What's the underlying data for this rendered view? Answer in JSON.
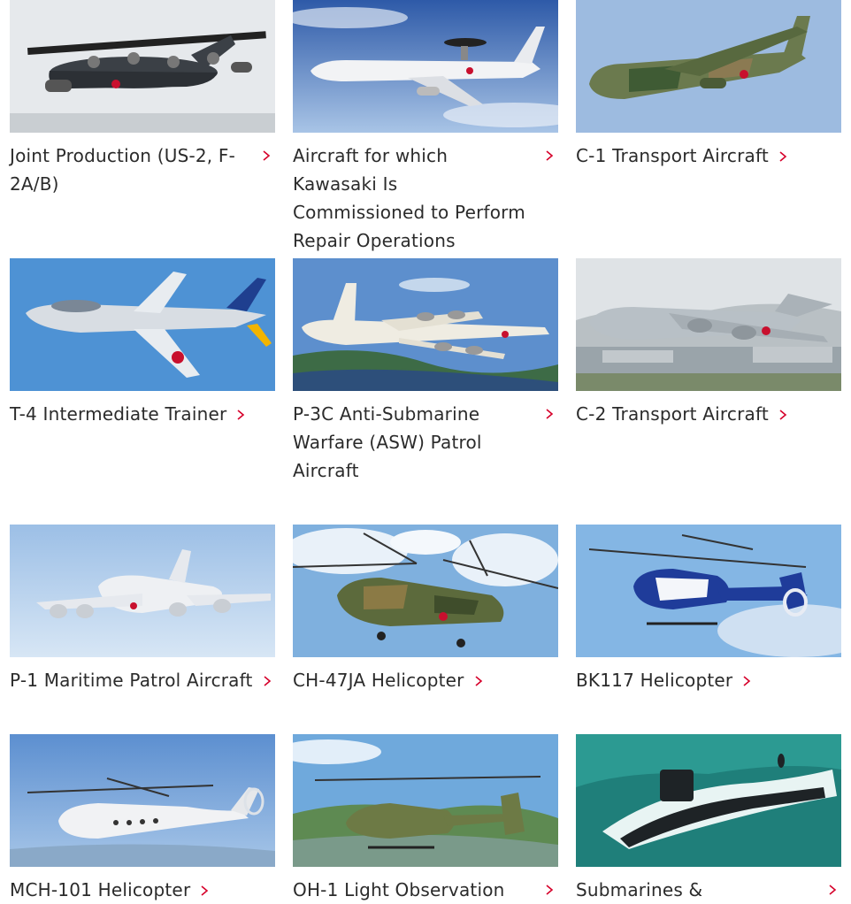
{
  "accent_color": "#d6002a",
  "cards": [
    {
      "label": "Joint Production (US-2, F-2A/B)",
      "image": "amphibian-aircraft-image"
    },
    {
      "label": "Aircraft for which Kawasaki Is Commissioned to Perform Repair Operations",
      "image": "awacs-aircraft-image"
    },
    {
      "label": "C-1 Transport Aircraft",
      "image": "c1-transport-image"
    },
    {
      "label": "T-4 Intermediate Trainer",
      "image": "t4-trainer-image"
    },
    {
      "label": "P-3C Anti-Submarine Warfare (ASW) Patrol Aircraft",
      "image": "p3c-patrol-image"
    },
    {
      "label": "C-2 Transport Aircraft",
      "image": "c2-transport-image"
    },
    {
      "label": "P-1 Maritime Patrol Aircraft",
      "image": "p1-patrol-image"
    },
    {
      "label": "CH-47JA Helicopter",
      "image": "ch47-helicopter-image"
    },
    {
      "label": "BK117 Helicopter",
      "image": "bk117-helicopter-image"
    },
    {
      "label": "MCH-101 Helicopter",
      "image": "mch101-helicopter-image"
    },
    {
      "label": "OH-1 Light Observation",
      "image": "oh1-helicopter-image"
    },
    {
      "label": "Submarines &",
      "image": "submarine-image"
    }
  ]
}
